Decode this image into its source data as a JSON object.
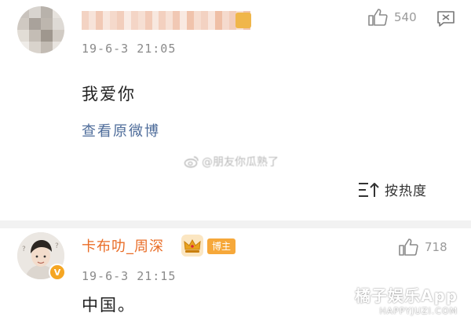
{
  "comment1": {
    "timestamp": "19-6-3 21:05",
    "like_count": "540",
    "text": "我爱你",
    "view_original_link": "查看原微博",
    "avatar_pixels": [
      "#c9c3bd",
      "#d8d4cf",
      "#b8b2ab",
      "#e6e2dd",
      "#cfc9c2",
      "#a9a29b",
      "#bdb6ae",
      "#dedad5",
      "#e2ddd6",
      "#c4bdb5",
      "#9f978e",
      "#d1cbc4",
      "#efece8",
      "#d9d3cc",
      "#c2bbb3",
      "#e8e4df"
    ],
    "name_pixels": [
      "#f3d3c3",
      "#f7e3d9",
      "#f1c9b5",
      "#f8e6dd",
      "#f5d9cb",
      "#f2cebc",
      "#f9ebe4",
      "#f4d5c6",
      "#f6dfd3",
      "#f2cbb8",
      "#f8e8df",
      "#f3d0bf",
      "#f7e1d6",
      "#f1c8b4",
      "#f9e9e1",
      "#f0c3ac",
      "#f6ddd0",
      "#f3d2c2",
      "#f8e5dc",
      "#efbfa6",
      "#f5dacd",
      "#f2cdbb",
      "#f7e2d7",
      "#f0c5b0"
    ]
  },
  "watermark": {
    "text": "@朋友你瓜熟了"
  },
  "sort_button": {
    "label": "按热度"
  },
  "comment2": {
    "username": "卡布叻_周深",
    "badge": "博主",
    "timestamp": "19-6-3 21:15",
    "like_count": "718",
    "text": "中国。",
    "verified_mark": "V"
  },
  "app_watermark": {
    "main": "橘子娱乐App",
    "sub": "HAPPYJUZI.COM"
  },
  "colors": {
    "username": "#e96d27",
    "link": "#4e6c9a",
    "badge_bg": "#f6a83a",
    "timestamp": "#8a8a8a"
  }
}
